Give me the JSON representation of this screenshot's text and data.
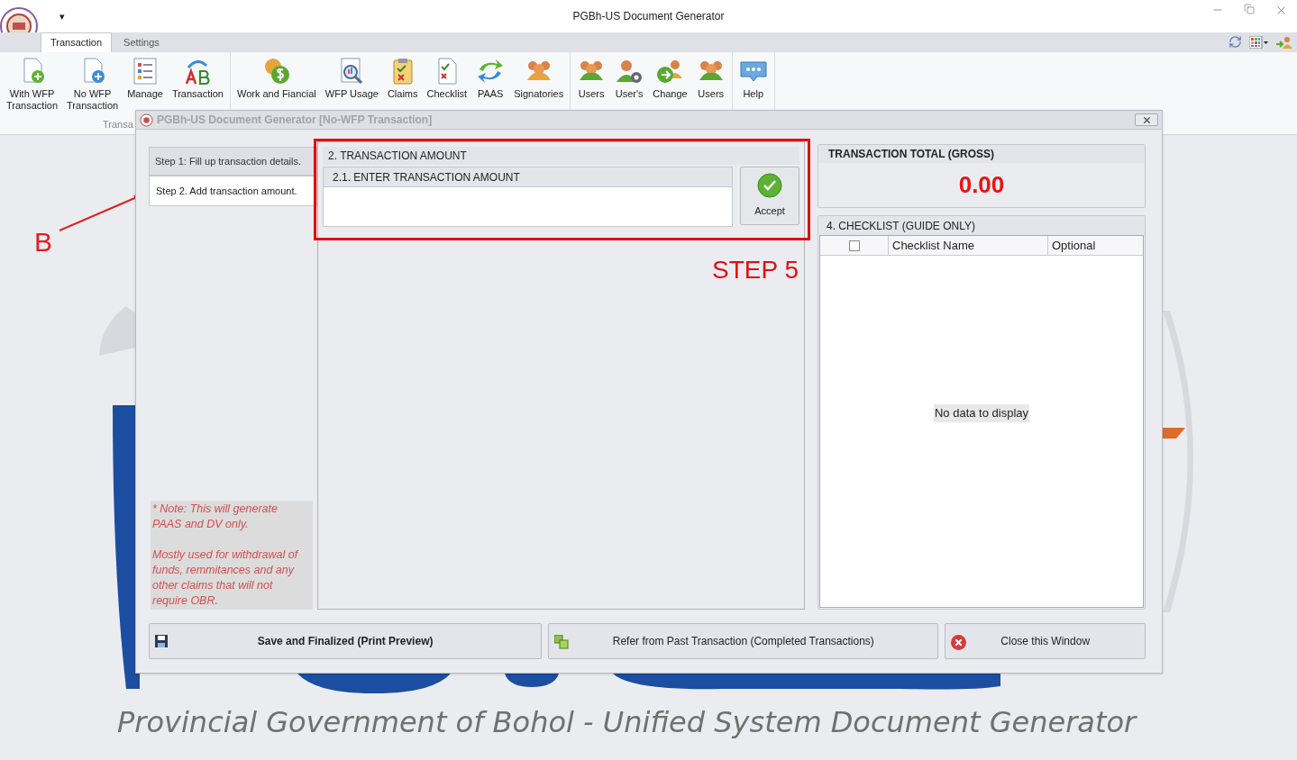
{
  "window": {
    "title": "PGBh-US Document Generator",
    "quick_access": "▾"
  },
  "ribbon_tabs": [
    {
      "label": "Transaction",
      "selected": true
    },
    {
      "label": "Settings",
      "selected": false
    }
  ],
  "ribbon_groups": [
    {
      "label": "Transa",
      "items": [
        [
          "With WFP",
          "Transaction"
        ],
        [
          "No WFP",
          "Transaction"
        ],
        [
          "Manage"
        ],
        [
          "Transaction"
        ]
      ]
    },
    {
      "items": [
        [
          "Work and Fiancial"
        ],
        [
          "WFP Usage"
        ],
        [
          "Claims"
        ],
        [
          "Checklist"
        ],
        [
          "PAAS"
        ],
        [
          "Signatories"
        ]
      ]
    },
    {
      "items": [
        [
          "Users"
        ],
        [
          "User's"
        ],
        [
          "Change"
        ],
        [
          "Users"
        ]
      ]
    },
    {
      "items": [
        [
          "Help"
        ]
      ]
    }
  ],
  "dialog": {
    "title": "PGBh-US Document Generator [No-WFP Transaction]",
    "steps": [
      {
        "label": "Step 1: Fill up transaction details.",
        "selected": false
      },
      {
        "label": "Step 2. Add transaction amount.",
        "selected": true
      }
    ],
    "note": [
      "* Note: This will generate PAAS and DV only.",
      "Mostly used for withdrawal of funds, remmitances and any other claims that will not require OBR."
    ],
    "amount": {
      "title": "2. TRANSACTION AMOUNT",
      "field_label": "2.1. ENTER TRANSACTION AMOUNT",
      "accept": "Accept"
    },
    "total": {
      "title": "TRANSACTION TOTAL (GROSS)",
      "value": "0.00"
    },
    "checklist": {
      "title": "4. CHECKLIST (GUIDE ONLY)",
      "select_all_checked": false,
      "columns": [
        "Checklist Name",
        "Optional"
      ],
      "empty_text": "No data to display"
    },
    "buttons": [
      {
        "label": "Save and Finalized (Print Preview)",
        "kind": "save"
      },
      {
        "label": "Refer from Past Transaction (Completed Transactions)",
        "kind": "refer"
      },
      {
        "label": "Close this Window",
        "kind": "close"
      }
    ]
  },
  "banner": "Provincial Government of Bohol - Unified System Document Generator",
  "annotations": {
    "marker": "B",
    "step": "STEP 5"
  }
}
